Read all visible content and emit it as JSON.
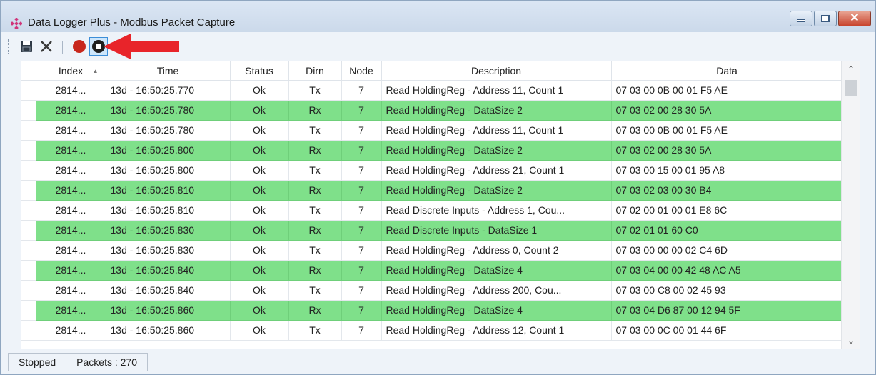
{
  "window": {
    "title": "Data Logger Plus - Modbus Packet Capture",
    "controls": {
      "minimize_icon": "minimize-icon",
      "maximize_icon": "maximize-icon",
      "close_label": "✕"
    }
  },
  "toolbar": {
    "buttons": [
      {
        "name": "save",
        "icon": "save-icon"
      },
      {
        "name": "clear",
        "icon": "clear-icon"
      },
      {
        "name": "record",
        "icon": "record-icon"
      },
      {
        "name": "stop",
        "icon": "stop-icon"
      }
    ],
    "annotation": "red-arrow-icon"
  },
  "colors": {
    "rx_row": "#7fe08a",
    "record": "#c8271c",
    "arrow": "#e8242a"
  },
  "table": {
    "columns": [
      "Index",
      "Time",
      "Status",
      "Dirn",
      "Node",
      "Description",
      "Data"
    ],
    "rows": [
      {
        "index": "2814...",
        "time": "13d - 16:50:25.770",
        "status": "Ok",
        "dirn": "Tx",
        "node": "7",
        "description": "Read HoldingReg - Address 11, Count 1",
        "data": "07 03 00 0B 00 01 F5 AE"
      },
      {
        "index": "2814...",
        "time": "13d - 16:50:25.780",
        "status": "Ok",
        "dirn": "Rx",
        "node": "7",
        "description": "Read HoldingReg - DataSize 2",
        "data": "07 03 02 00 28 30 5A"
      },
      {
        "index": "2814...",
        "time": "13d - 16:50:25.780",
        "status": "Ok",
        "dirn": "Tx",
        "node": "7",
        "description": "Read HoldingReg - Address 11, Count 1",
        "data": "07 03 00 0B 00 01 F5 AE"
      },
      {
        "index": "2814...",
        "time": "13d - 16:50:25.800",
        "status": "Ok",
        "dirn": "Rx",
        "node": "7",
        "description": "Read HoldingReg - DataSize 2",
        "data": "07 03 02 00 28 30 5A"
      },
      {
        "index": "2814...",
        "time": "13d - 16:50:25.800",
        "status": "Ok",
        "dirn": "Tx",
        "node": "7",
        "description": "Read HoldingReg - Address 21, Count 1",
        "data": "07 03 00 15 00 01 95 A8"
      },
      {
        "index": "2814...",
        "time": "13d - 16:50:25.810",
        "status": "Ok",
        "dirn": "Rx",
        "node": "7",
        "description": "Read HoldingReg - DataSize 2",
        "data": "07 03 02 03 00 30 B4"
      },
      {
        "index": "2814...",
        "time": "13d - 16:50:25.810",
        "status": "Ok",
        "dirn": "Tx",
        "node": "7",
        "description": "Read Discrete Inputs - Address 1, Cou...",
        "data": "07 02 00 01 00 01 E8 6C"
      },
      {
        "index": "2814...",
        "time": "13d - 16:50:25.830",
        "status": "Ok",
        "dirn": "Rx",
        "node": "7",
        "description": "Read Discrete Inputs - DataSize 1",
        "data": "07 02 01 01 60 C0"
      },
      {
        "index": "2814...",
        "time": "13d - 16:50:25.830",
        "status": "Ok",
        "dirn": "Tx",
        "node": "7",
        "description": "Read HoldingReg - Address 0, Count 2",
        "data": "07 03 00 00 00 02 C4 6D"
      },
      {
        "index": "2814...",
        "time": "13d - 16:50:25.840",
        "status": "Ok",
        "dirn": "Rx",
        "node": "7",
        "description": "Read HoldingReg - DataSize 4",
        "data": "07 03 04 00 00 42 48 AC A5"
      },
      {
        "index": "2814...",
        "time": "13d - 16:50:25.840",
        "status": "Ok",
        "dirn": "Tx",
        "node": "7",
        "description": "Read HoldingReg - Address 200, Cou...",
        "data": "07 03 00 C8 00 02 45 93"
      },
      {
        "index": "2814...",
        "time": "13d - 16:50:25.860",
        "status": "Ok",
        "dirn": "Rx",
        "node": "7",
        "description": "Read HoldingReg - DataSize 4",
        "data": "07 03 04 D6 87 00 12 94 5F"
      },
      {
        "index": "2814...",
        "time": "13d - 16:50:25.860",
        "status": "Ok",
        "dirn": "Tx",
        "node": "7",
        "description": "Read HoldingReg - Address 12, Count 1",
        "data": "07 03 00 0C 00 01 44 6F"
      }
    ]
  },
  "statusbar": {
    "state": "Stopped",
    "packets": "Packets : 270"
  }
}
